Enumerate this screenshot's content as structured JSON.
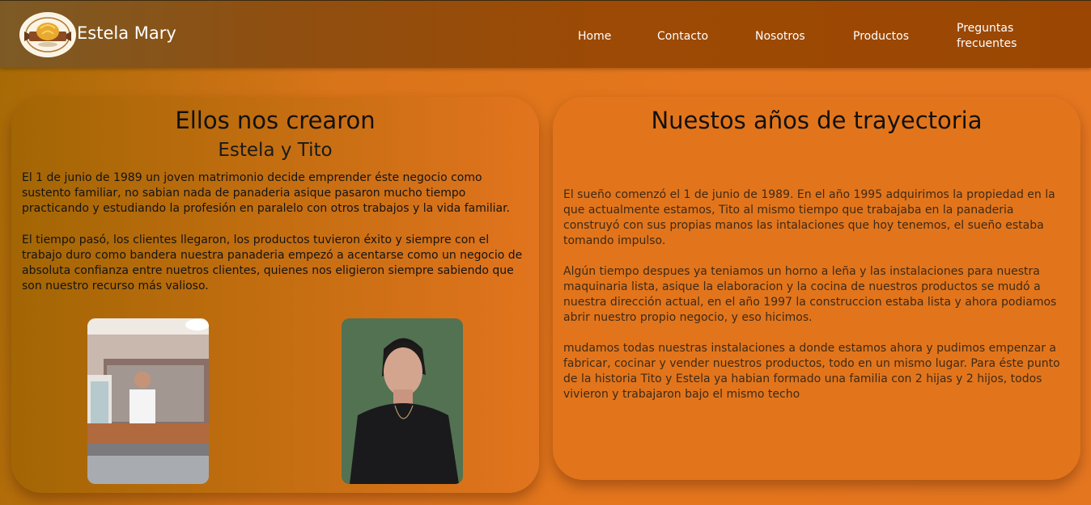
{
  "header": {
    "brand": "Estela Mary",
    "logo_icon": "bread-basket-logo-icon",
    "nav": [
      {
        "label": "Home"
      },
      {
        "label": "Contacto"
      },
      {
        "label": "Nosotros"
      },
      {
        "label": "Productos"
      },
      {
        "label": "Preguntas frecuentes"
      }
    ]
  },
  "left_card": {
    "title": "Ellos nos crearon",
    "subtitle": "Estela y Tito",
    "paragraphs": [
      "El 1 de junio de 1989 un joven matrimonio decide emprender éste negocio como sustento familiar, no sabian nada de panaderia asique pasaron mucho tiempo practicando y estudiando la profesión en paralelo con otros trabajos y la vida familiar.",
      "El tiempo pasó, los clientes llegaron, los productos tuvieron éxito y siempre con el trabajo duro como bandera nuestra panaderia empezó a acentarse como un negocio de absoluta confianza entre nuetros clientes, quienes nos eligieron siempre sabiendo que son nuestro recurso más valioso."
    ]
  },
  "right_card": {
    "title": "Nuestos años de trayectoria",
    "paragraphs": [
      "El sueño comenzó el 1 de junio de 1989. En el año 1995 adquirimos la propiedad en la que actualmente estamos, Tito al mismo tiempo que trabajaba en la panaderia construyó con sus propias manos las intalaciones que hoy tenemos, el sueño estaba tomando impulso.",
      "Algún tiempo despues ya teniamos un horno a leña y las instalaciones para nuestra maquinaria lista, asique la elaboracion y la cocina de nuestros productos se mudó a nuestra dirección actual, en el año 1997 la construccion estaba lista y ahora podiamos abrir nuestro propio negocio, y eso hicimos.",
      "mudamos todas nuestras instalaciones a donde estamos ahora y pudimos empenzar a fabricar, cocinar y vender nuestros productos, todo en un mismo lugar. Para éste punto de la historia Tito y Estela ya habian formado una familia con 2 hijas y 2 hijos, todos vivieron y trabajaron bajo el mismo techo"
    ]
  },
  "colors": {
    "header_bg": "#9b4703",
    "page_bg": "#e5761d",
    "card_right_bg": "#e2751b",
    "text_dark": "#141414"
  }
}
